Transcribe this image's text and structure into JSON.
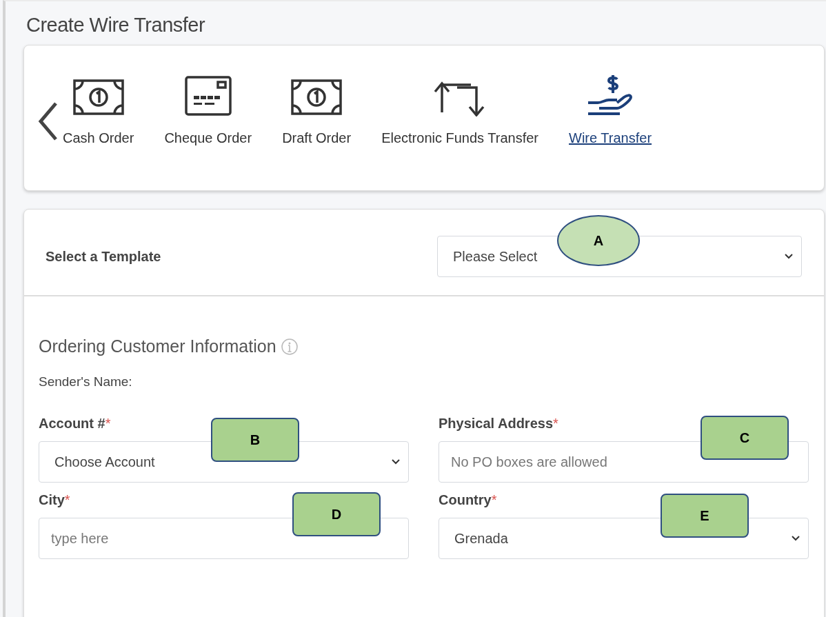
{
  "page_title": "Create Wire Transfer",
  "order_types": [
    {
      "label": "Cash Order",
      "kind": "bill",
      "selected": false
    },
    {
      "label": "Cheque Order",
      "kind": "cheque",
      "selected": false
    },
    {
      "label": "Draft Order",
      "kind": "bill",
      "selected": false
    },
    {
      "label": "Electronic Funds Transfer",
      "kind": "transfer",
      "selected": false
    },
    {
      "label": "Wire Transfer",
      "kind": "payment",
      "selected": true
    }
  ],
  "template": {
    "label": "Select a Template",
    "value": "Please Select",
    "callout": {
      "label": "A",
      "kind": "ellipse"
    }
  },
  "section": {
    "title": "Ordering Customer Information",
    "sender_label": "Sender's Name:"
  },
  "fields": [
    {
      "label": "Account #",
      "required_mark": "*",
      "kind": "select",
      "value": "Choose Account",
      "callout": {
        "label": "B",
        "kind": "rect"
      }
    },
    {
      "label": "Physical Address",
      "required_mark": "*",
      "kind": "text",
      "placeholder": "No PO boxes are allowed",
      "callout": {
        "label": "C",
        "kind": "rect"
      }
    },
    {
      "label": "City",
      "required_mark": "*",
      "kind": "text",
      "placeholder": "type here",
      "callout": {
        "label": "D",
        "kind": "rect"
      }
    },
    {
      "label": "Country",
      "required_mark": "*",
      "kind": "select",
      "value": "Grenada",
      "callout": {
        "label": "E",
        "kind": "rect"
      }
    }
  ]
}
